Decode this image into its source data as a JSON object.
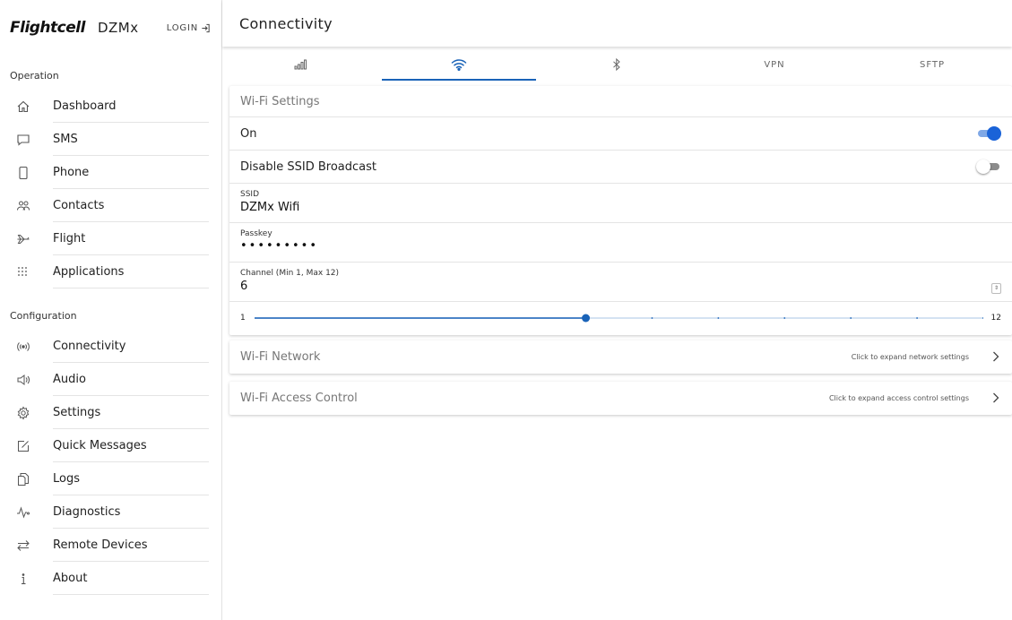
{
  "brand": {
    "logo": "Flightcell",
    "product": "DZMx",
    "login_label": "LOGIN"
  },
  "sidebar": {
    "operation_label": "Operation",
    "operation_items": [
      {
        "label": "Dashboard",
        "icon": "home-icon"
      },
      {
        "label": "SMS",
        "icon": "chat-icon"
      },
      {
        "label": "Phone",
        "icon": "phone-icon"
      },
      {
        "label": "Contacts",
        "icon": "contacts-icon"
      },
      {
        "label": "Flight",
        "icon": "plane-icon"
      },
      {
        "label": "Applications",
        "icon": "apps-grid-icon"
      }
    ],
    "configuration_label": "Configuration",
    "configuration_items": [
      {
        "label": "Connectivity",
        "icon": "connectivity-icon"
      },
      {
        "label": "Audio",
        "icon": "speaker-icon"
      },
      {
        "label": "Settings",
        "icon": "gear-icon"
      },
      {
        "label": "Quick Messages",
        "icon": "edit-icon"
      },
      {
        "label": "Logs",
        "icon": "documents-icon"
      },
      {
        "label": "Diagnostics",
        "icon": "pulse-icon"
      },
      {
        "label": "Remote Devices",
        "icon": "swap-icon"
      },
      {
        "label": "About",
        "icon": "info-icon"
      }
    ]
  },
  "header": {
    "title": "Connectivity"
  },
  "tabs": [
    {
      "label": "",
      "icon": "cellular-signal-icon",
      "active": false
    },
    {
      "label": "",
      "icon": "wifi-icon",
      "active": true
    },
    {
      "label": "",
      "icon": "bluetooth-icon",
      "active": false
    },
    {
      "label": "VPN",
      "icon": "",
      "active": false
    },
    {
      "label": "SFTP",
      "icon": "",
      "active": false
    }
  ],
  "wifi_settings": {
    "title": "Wi-Fi Settings",
    "on_label": "On",
    "on_value": true,
    "disable_ssid_label": "Disable SSID Broadcast",
    "disable_ssid_value": false,
    "ssid_label": "SSID",
    "ssid_value": "DZMx Wifi",
    "passkey_label": "Passkey",
    "passkey_value": "•••••••••",
    "channel_label": "Channel (Min 1, Max 12)",
    "channel_value": "6",
    "slider_min": "1",
    "slider_max": "12",
    "slider_value": 6,
    "slider_min_num": 1,
    "slider_max_num": 12
  },
  "wifi_network": {
    "title": "Wi-Fi Network",
    "hint": "Click to expand network settings"
  },
  "wifi_access": {
    "title": "Wi-Fi Access Control",
    "hint": "Click to expand access control settings"
  },
  "colors": {
    "accent": "#1a63b8",
    "toggle_on": "#1a63d8",
    "slider_track": "#c5d8ee"
  }
}
